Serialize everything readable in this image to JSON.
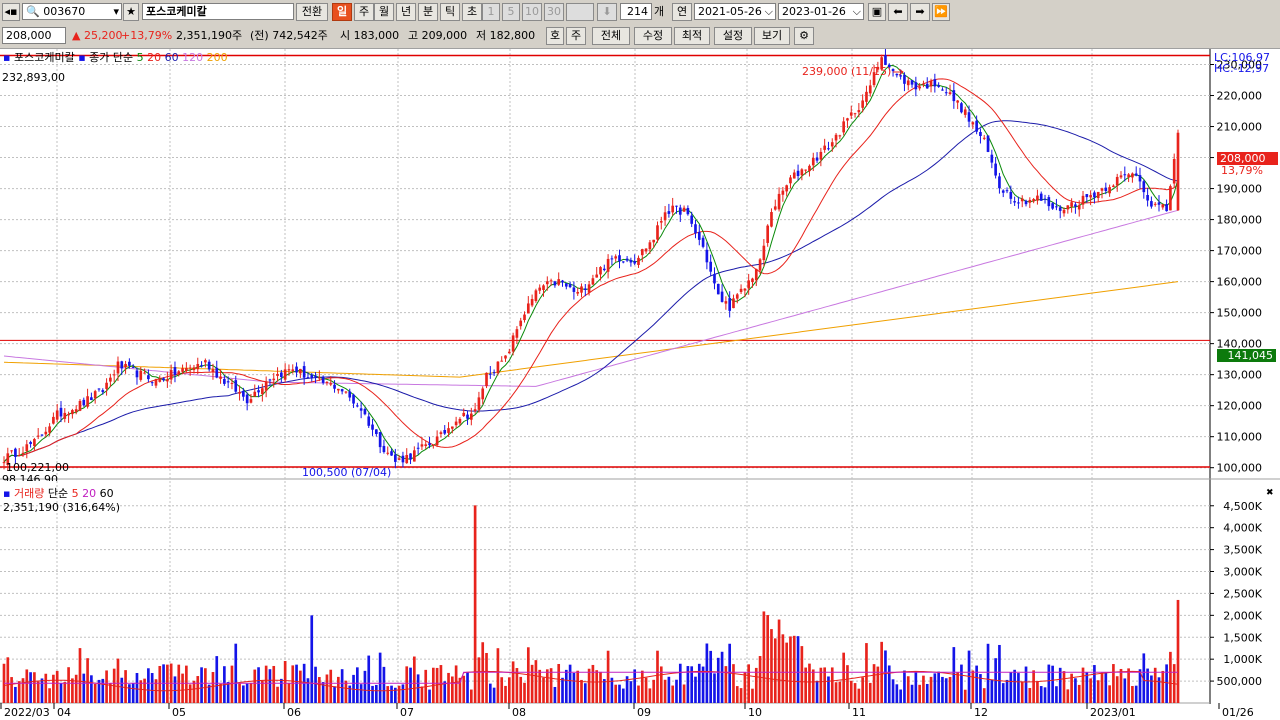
{
  "toolbar1": {
    "code": "003670",
    "name": "포스코케미칼",
    "switch_label": "전환",
    "periods": [
      "일",
      "주",
      "월",
      "년",
      "분",
      "틱",
      "초"
    ],
    "active_period": "일",
    "intervals": [
      "1",
      "5",
      "10",
      "30"
    ],
    "count": "214",
    "count_unit": "개",
    "date_label": "연",
    "start_date": "2021-05-26",
    "end_date": "2023-01-26"
  },
  "toolbar2": {
    "price": "208,000",
    "change": "▲ 25,200",
    "change_pct": "+13,79%",
    "volume": "2,351,190주",
    "prev": "(전) 742,542주",
    "open": "시 183,000",
    "high": "고 209,000",
    "low": "저 182,800",
    "buttons": [
      "호",
      "주",
      "전체",
      "수정",
      "최적",
      "설정",
      "보기"
    ]
  },
  "price_legend": {
    "name": "포스코케미칼",
    "type": "종가 단순",
    "ma": [
      "5",
      "20",
      "60",
      "120",
      "200"
    ],
    "high_ref": "232,893,00",
    "low_ref": "100,221,00",
    "low_ref2": "98,146,90",
    "lc": "LC:106,97",
    "hc": "HC:-12,97",
    "peak_note": "239,000 (11/15)",
    "trough_note": "100,500 (07/04)",
    "current_price": "208,000",
    "current_pct": "13,79%",
    "support_price": "141,045"
  },
  "volume_legend": {
    "name": "거래량",
    "type": "단순",
    "ma": [
      "5",
      "20",
      "60"
    ],
    "value": "2,351,190 (316,64%)"
  },
  "x_labels": [
    "2022/03",
    "04",
    "05",
    "06",
    "07",
    "08",
    "09",
    "10",
    "11",
    "12",
    "2023/01",
    "01/26"
  ],
  "chart_data": {
    "type": "candlestick",
    "price_axis": {
      "min": 100000,
      "max": 230000,
      "step": 10000,
      "labels": [
        "230,000",
        "220,000",
        "210,000",
        "200,000",
        "190,000",
        "180,000",
        "170,000",
        "160,000",
        "150,000",
        "140,000",
        "130,000",
        "120,000",
        "110,000",
        "100,000"
      ]
    },
    "volume_axis": {
      "labels": [
        "4,500K",
        "4,000K",
        "3,500K",
        "3,000K",
        "2,500K",
        "2,000K",
        "1,500K",
        "1,000K",
        "500,000"
      ]
    },
    "reference_lines": [
      232893,
      141045,
      100221
    ],
    "anchors": [
      [
        0,
        103000
      ],
      [
        8,
        108000
      ],
      [
        14,
        117000
      ],
      [
        21,
        121000
      ],
      [
        26,
        125000
      ],
      [
        30,
        133000
      ],
      [
        34,
        131000
      ],
      [
        40,
        128000
      ],
      [
        46,
        131000
      ],
      [
        53,
        134000
      ],
      [
        58,
        128000
      ],
      [
        64,
        122000
      ],
      [
        70,
        129000
      ],
      [
        76,
        132000
      ],
      [
        82,
        128000
      ],
      [
        88,
        126000
      ],
      [
        94,
        119000
      ],
      [
        99,
        108000
      ],
      [
        103,
        102000
      ],
      [
        107,
        104000
      ],
      [
        111,
        107000
      ],
      [
        115,
        110000
      ],
      [
        119,
        116000
      ],
      [
        124,
        118000
      ],
      [
        127,
        130000
      ],
      [
        132,
        135000
      ],
      [
        136,
        148000
      ],
      [
        141,
        158000
      ],
      [
        146,
        160000
      ],
      [
        151,
        156000
      ],
      [
        156,
        163000
      ],
      [
        161,
        168000
      ],
      [
        166,
        167000
      ],
      [
        171,
        174000
      ],
      [
        174,
        183000
      ],
      [
        179,
        183000
      ],
      [
        184,
        171000
      ],
      [
        188,
        155000
      ],
      [
        191,
        152000
      ],
      [
        195,
        158000
      ],
      [
        199,
        166000
      ],
      [
        202,
        183000
      ],
      [
        207,
        193000
      ],
      [
        212,
        198000
      ],
      [
        218,
        205000
      ],
      [
        222,
        212000
      ],
      [
        227,
        220000
      ],
      [
        231,
        233000
      ],
      [
        235,
        226000
      ],
      [
        240,
        223000
      ],
      [
        246,
        224000
      ],
      [
        252,
        216000
      ],
      [
        258,
        205000
      ],
      [
        262,
        191000
      ],
      [
        267,
        186000
      ],
      [
        272,
        187000
      ],
      [
        277,
        183000
      ],
      [
        283,
        186000
      ],
      [
        288,
        189000
      ],
      [
        293,
        193000
      ],
      [
        298,
        195000
      ],
      [
        302,
        185000
      ],
      [
        306,
        183000
      ],
      [
        309,
        208000
      ]
    ],
    "last_candle": {
      "open": 183000,
      "high": 209000,
      "low": 182800,
      "close": 208000
    },
    "last_volume": 2351190
  },
  "colors": {
    "up": "#e8231c",
    "down": "#1414e8",
    "ma5": "#0a8a0a",
    "ma20": "#e8231c",
    "ma60": "#1c1caa",
    "ma120": "#c878e0",
    "ma200": "#f0a000",
    "ref_line": "#e00000"
  }
}
